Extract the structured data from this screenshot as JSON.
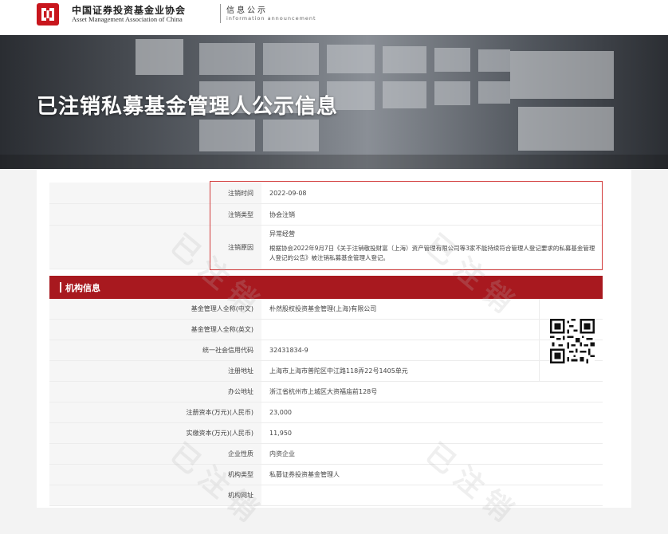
{
  "header": {
    "org_name_cn": "中国证券投资基金业协会",
    "org_name_en": "Asset Management Association of China",
    "section_cn": "信息公示",
    "section_en": "information announcement"
  },
  "banner": {
    "title": "已注销私募基金管理人公示信息"
  },
  "cancellation": {
    "fields": [
      {
        "label": "注销时间",
        "value": "2022-09-08"
      },
      {
        "label": "注销类型",
        "value": "协会注销"
      }
    ],
    "reason_label": "注销原因",
    "reason_title": "异常经营",
    "reason_text": "根据协会2022年9月7日《关于注销敬投财富（上海）资产管理有限公司等3家不能持续符合管理人登记要求的私募基金管理人登记的公告》被注销私募基金管理人登记。"
  },
  "org_section": {
    "title": "机构信息",
    "rows": [
      {
        "label": "基金管理人全称(中文)",
        "value": "朴然股权投资基金管理(上海)有限公司"
      },
      {
        "label": "基金管理人全称(英文)",
        "value": ""
      },
      {
        "label": "统一社会信用代码",
        "value": "32431834-9"
      },
      {
        "label": "注册地址",
        "value": "上海市上海市普陀区中江路118弄22号1405单元"
      },
      {
        "label": "办公地址",
        "value": "浙江省杭州市上城区大资福庙前128号"
      },
      {
        "label": "注册资本(万元)(人民币)",
        "value": "23,000"
      },
      {
        "label": "实缴资本(万元)(人民币)",
        "value": "11,950"
      },
      {
        "label": "企业性质",
        "value": "内资企业"
      },
      {
        "label": "机构类型",
        "value": "私募证券投资基金管理人"
      },
      {
        "label": "机构网址",
        "value": ""
      }
    ]
  },
  "watermark_text": "已注销",
  "colors": {
    "brand_red": "#a8191f",
    "highlight_border": "#d23a3a"
  }
}
